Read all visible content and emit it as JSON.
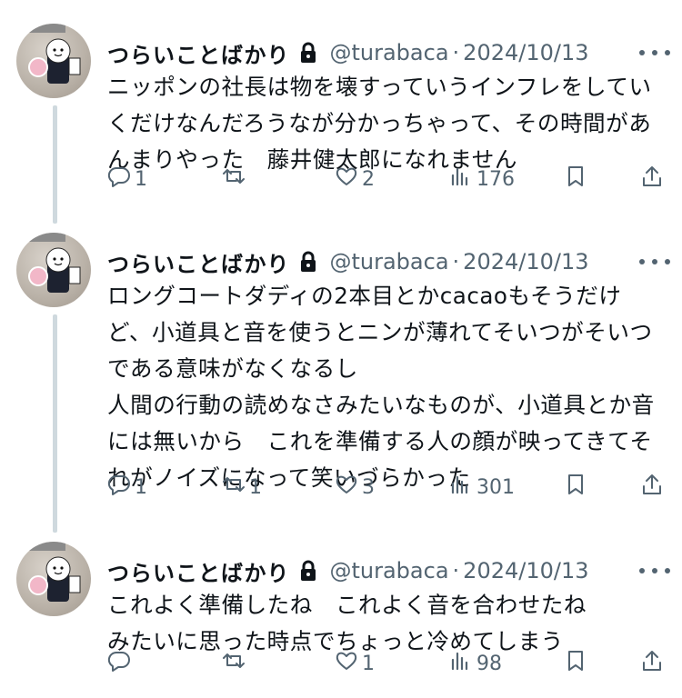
{
  "tweets": [
    {
      "name": "つらいことばかり",
      "handle": "@turabaca",
      "separator": "·",
      "date": "2024/10/13",
      "text": "ニッポンの社長は物を壊すっていうインフレをしていくだけなんだろうなが分かっちゃって、その時間があんまりやった　藤井健太郎になれません",
      "replies": "1",
      "retweets": "",
      "likes": "2",
      "views": "176"
    },
    {
      "name": "つらいことばかり",
      "handle": "@turabaca",
      "separator": "·",
      "date": "2024/10/13",
      "text": "ロングコートダディの2本目とかcacaoもそうだけど、小道具と音を使うとニンが薄れてそいつがそいつである意味がなくなるし\n人間の行動の読めなさみたいなものが、小道具とか音には無いから　これを準備する人の顔が映ってきてそれがノイズになって笑いづらかった",
      "replies": "1",
      "retweets": "1",
      "likes": "3",
      "views": "301"
    },
    {
      "name": "つらいことばかり",
      "handle": "@turabaca",
      "separator": "·",
      "date": "2024/10/13",
      "text": "これよく準備したね　これよく音を合わせたね\nみたいに思った時点でちょっと冷めてしまう",
      "replies": "",
      "retweets": "",
      "likes": "1",
      "views": "98"
    }
  ],
  "icons": [
    "lock-icon",
    "more-icon",
    "reply-icon",
    "retweet-icon",
    "like-icon",
    "views-icon",
    "bookmark-icon",
    "share-icon"
  ],
  "colors": {
    "text": "#0f1419",
    "secondary": "#536471",
    "thread_line": "#cfd9de"
  }
}
